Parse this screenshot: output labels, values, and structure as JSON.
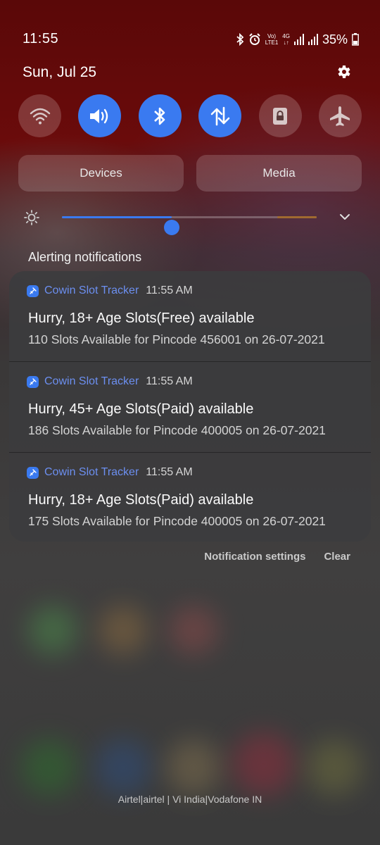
{
  "status_bar": {
    "time": "11:55",
    "net_label_top": "Vo)",
    "net_label_bottom": "LTE1",
    "net_gen": "4G",
    "battery": "35%"
  },
  "date": "Sun, Jul 25",
  "quick_toggles": [
    {
      "name": "wifi-icon",
      "state": "off"
    },
    {
      "name": "sound-icon",
      "state": "on"
    },
    {
      "name": "bluetooth-icon",
      "state": "on"
    },
    {
      "name": "mobile-data-icon",
      "state": "on"
    },
    {
      "name": "lock-icon",
      "state": "off"
    },
    {
      "name": "airplane-icon",
      "state": "off"
    }
  ],
  "panel_buttons": {
    "devices": "Devices",
    "media": "Media"
  },
  "brightness_level": 0.43,
  "section_title": "Alerting notifications",
  "notifications": [
    {
      "app": "Cowin Slot Tracker",
      "time": "11:55 AM",
      "title": "Hurry, 18+ Age Slots(Free) available",
      "body": "110 Slots Available for Pincode 456001 on 26-07-2021"
    },
    {
      "app": "Cowin Slot Tracker",
      "time": "11:55 AM",
      "title": "Hurry, 45+ Age Slots(Paid) available",
      "body": "186 Slots Available for Pincode 400005 on 26-07-2021"
    },
    {
      "app": "Cowin Slot Tracker",
      "time": "11:55 AM",
      "title": "Hurry, 18+ Age Slots(Paid) available",
      "body": "175 Slots Available for Pincode 400005 on 26-07-2021"
    }
  ],
  "actions": {
    "settings": "Notification settings",
    "clear": "Clear"
  },
  "carrier": "Airtel|airtel | Vi India|Vodafone IN",
  "colors": {
    "accent": "#3a7af0",
    "app_name": "#6c8ff0"
  }
}
